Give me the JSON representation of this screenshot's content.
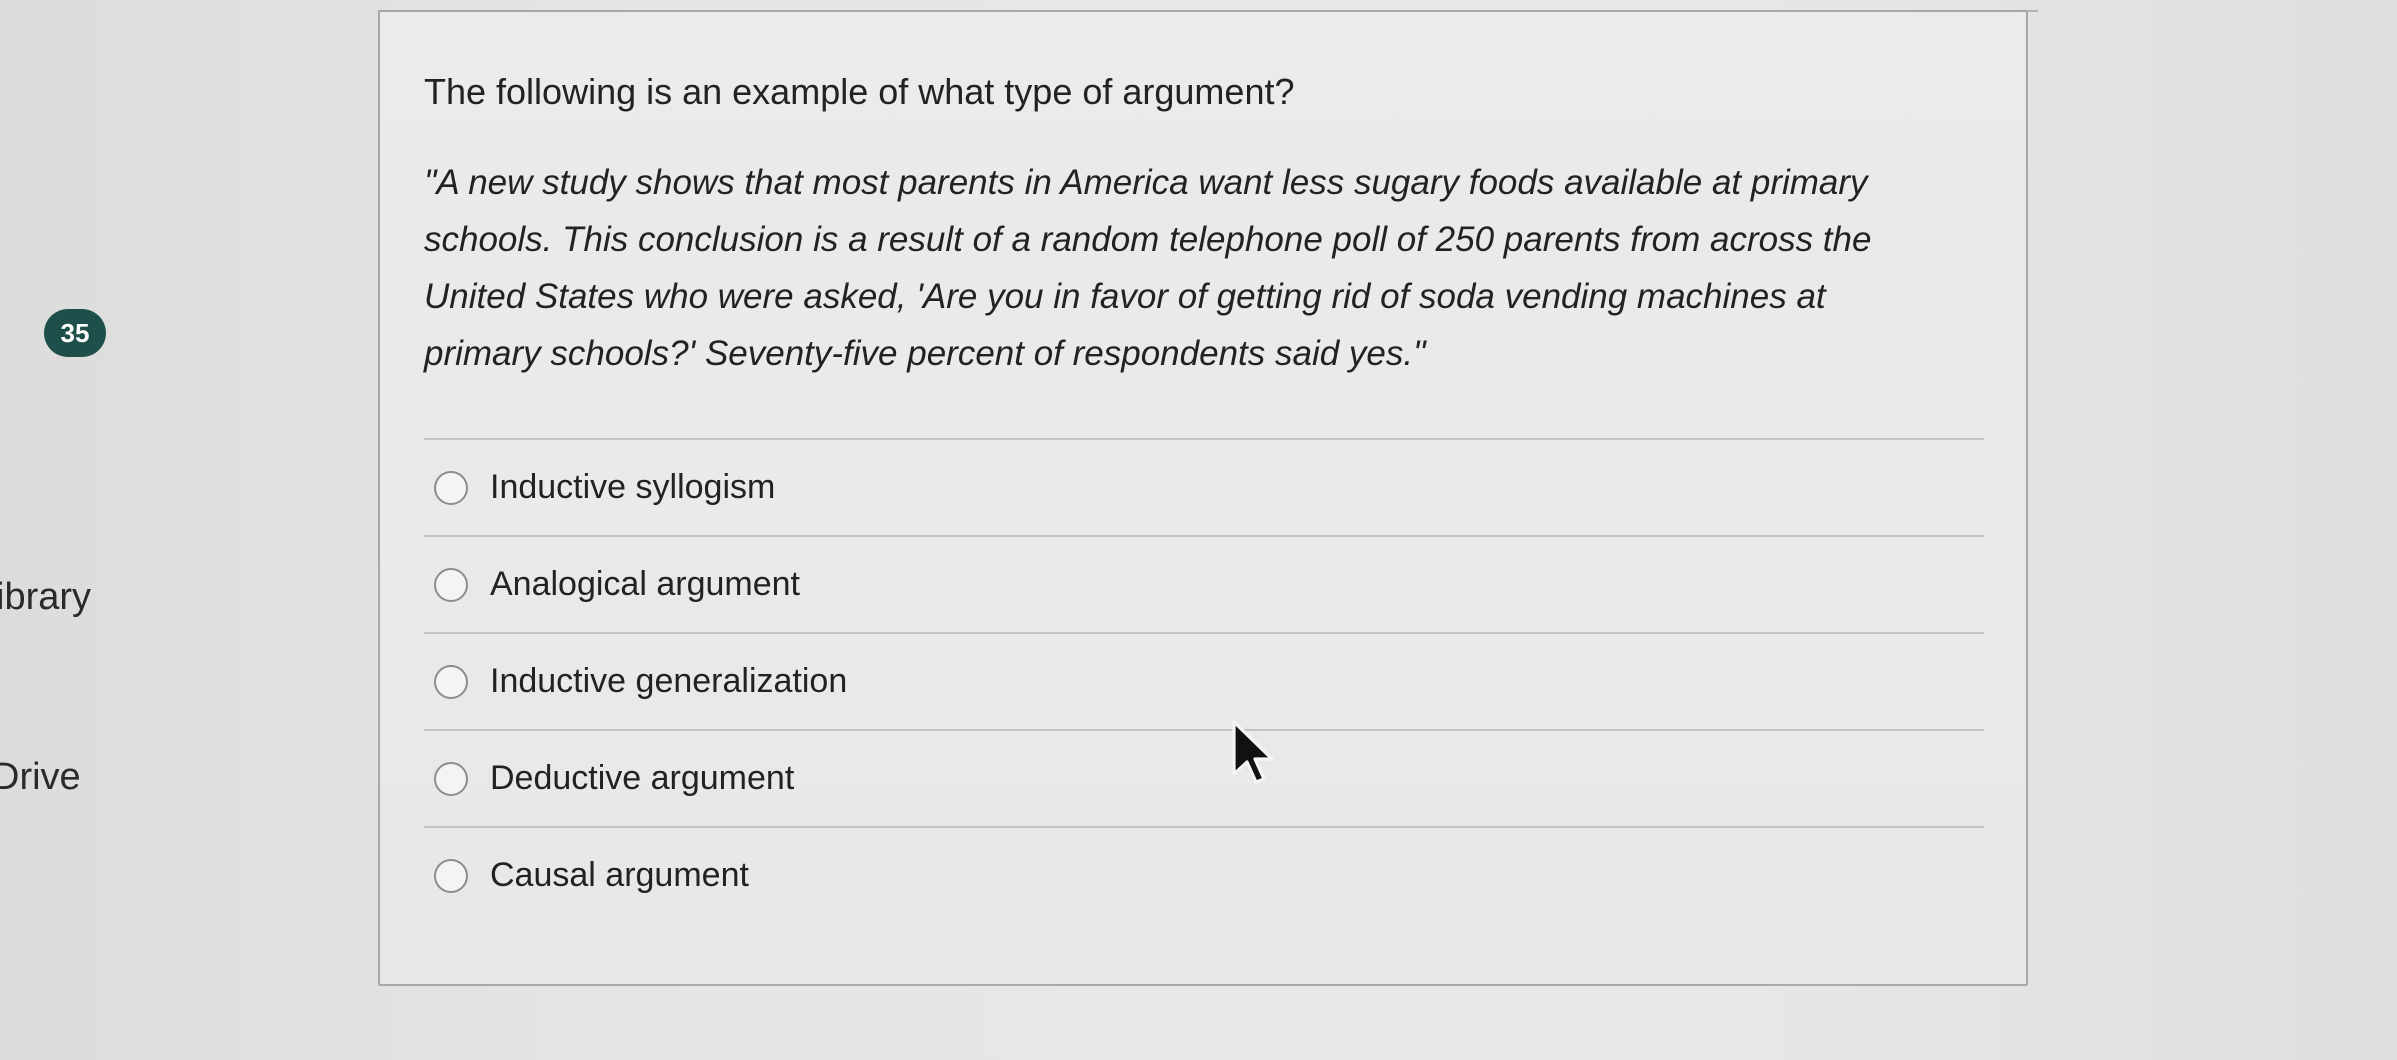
{
  "nav": {
    "question_number": "35",
    "library_label": "ibrary",
    "drive_label": "Drive"
  },
  "question": {
    "prompt": "The following is an example of what type of argument?",
    "passage": "\"A new study shows that most parents in America want less sugary foods available at primary schools. This conclusion is a result of a random telephone poll of 250 parents from across the United States who were asked, 'Are you in favor of getting rid of soda vending machines at primary schools?' Seventy-five percent of respondents said yes.\"",
    "options": [
      {
        "label": "Inductive syllogism"
      },
      {
        "label": "Analogical argument"
      },
      {
        "label": "Inductive generalization"
      },
      {
        "label": "Deductive argument"
      },
      {
        "label": "Causal argument"
      }
    ]
  },
  "colors": {
    "badge": "#1f4f4a",
    "card_border": "#a8a8a8"
  },
  "icons": {
    "cursor": "mouse-pointer-icon",
    "radio": "radio-button-icon"
  }
}
